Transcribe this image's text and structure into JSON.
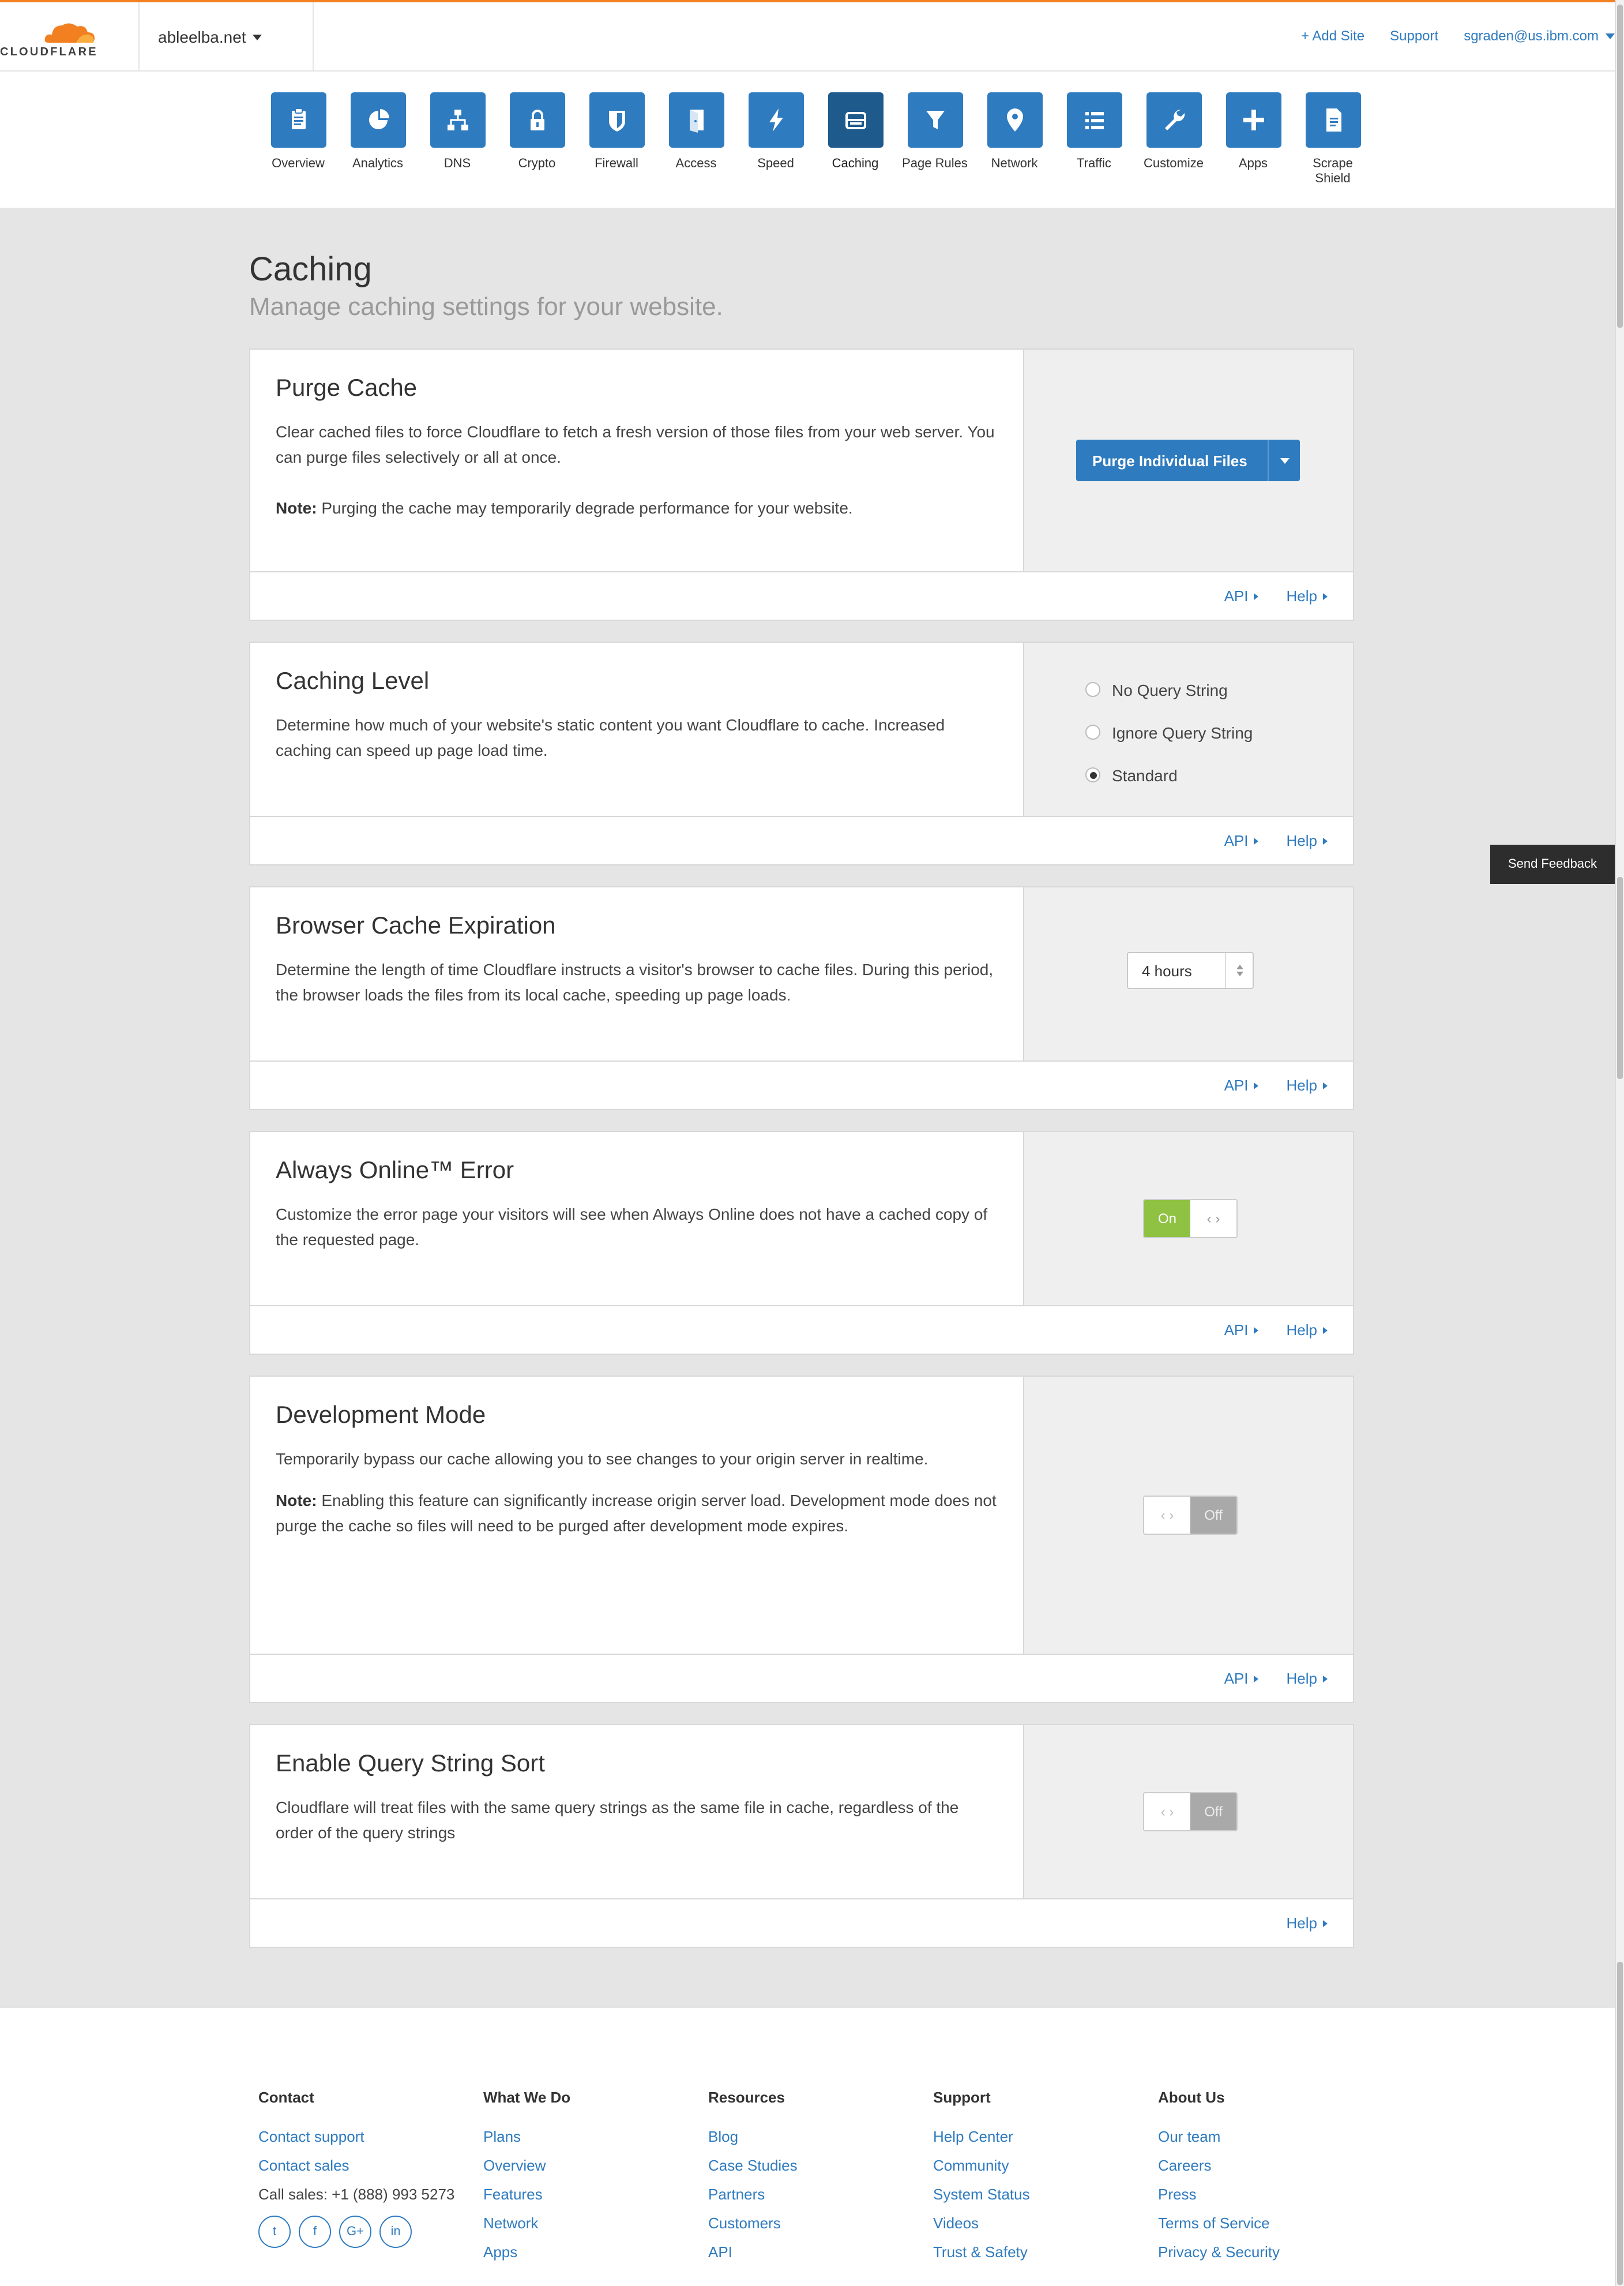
{
  "brand": {
    "logo_text": "CLOUDFLARE",
    "accent": "#f38020",
    "primary": "#2f7bbf"
  },
  "header": {
    "domain": "ableelba.net",
    "add_site": "+ Add Site",
    "support": "Support",
    "account": "sgraden@us.ibm.com"
  },
  "nav": [
    {
      "label": "Overview",
      "icon": "clipboard-icon"
    },
    {
      "label": "Analytics",
      "icon": "pie-chart-icon"
    },
    {
      "label": "DNS",
      "icon": "network-tree-icon"
    },
    {
      "label": "Crypto",
      "icon": "lock-icon"
    },
    {
      "label": "Firewall",
      "icon": "shield-icon"
    },
    {
      "label": "Access",
      "icon": "door-icon"
    },
    {
      "label": "Speed",
      "icon": "lightning-icon"
    },
    {
      "label": "Caching",
      "icon": "server-drive-icon",
      "active": true
    },
    {
      "label": "Page Rules",
      "icon": "filter-icon"
    },
    {
      "label": "Network",
      "icon": "location-pin-icon"
    },
    {
      "label": "Traffic",
      "icon": "list-icon"
    },
    {
      "label": "Customize",
      "icon": "wrench-icon"
    },
    {
      "label": "Apps",
      "icon": "plus-icon"
    },
    {
      "label": "Scrape Shield",
      "icon": "document-icon"
    }
  ],
  "page": {
    "title": "Caching",
    "subtitle": "Manage caching settings for your website."
  },
  "cards": {
    "purge": {
      "title": "Purge Cache",
      "desc": "Clear cached files to force Cloudflare to fetch a fresh version of those files from your web server. You can purge files selectively or all at once.",
      "note_label": "Note:",
      "note": " Purging the cache may temporarily degrade performance for your website.",
      "button": "Purge Individual Files",
      "api": "API",
      "help": "Help"
    },
    "level": {
      "title": "Caching Level",
      "desc": "Determine how much of your website's static content you want Cloudflare to cache. Increased caching can speed up page load time.",
      "options": [
        "No Query String",
        "Ignore Query String",
        "Standard"
      ],
      "selected": "Standard",
      "api": "API",
      "help": "Help"
    },
    "browser": {
      "title": "Browser Cache Expiration",
      "desc": "Determine the length of time Cloudflare instructs a visitor's browser to cache files. During this period, the browser loads the files from its local cache, speeding up page loads.",
      "value": "4 hours",
      "api": "API",
      "help": "Help"
    },
    "online": {
      "title": "Always Online™ Error",
      "desc": "Customize the error page your visitors will see when Always Online does not have a cached copy of the requested page.",
      "on_label": "On",
      "handle": "‹ ›",
      "state": "On",
      "api": "API",
      "help": "Help"
    },
    "devmode": {
      "title": "Development Mode",
      "desc": "Temporarily bypass our cache allowing you to see changes to your origin server in realtime.",
      "note_label": "Note:",
      "note": " Enabling this feature can significantly increase origin server load. Development mode does not purge the cache so files will need to be purged after development mode expires.",
      "handle": "‹ ›",
      "off_label": "Off",
      "state": "Off",
      "api": "API",
      "help": "Help"
    },
    "qsort": {
      "title": "Enable Query String Sort",
      "desc": "Cloudflare will treat files with the same query strings as the same file in cache, regardless of the order of the query strings",
      "handle": "‹ ›",
      "off_label": "Off",
      "state": "Off",
      "help": "Help"
    }
  },
  "feedback": "Send Feedback",
  "footer": {
    "contact": {
      "title": "Contact",
      "links": [
        "Contact support",
        "Contact sales"
      ],
      "call": "Call sales: +1 (888) 993 5273",
      "socials": [
        "t",
        "f",
        "G+",
        "in"
      ]
    },
    "what": {
      "title": "What We Do",
      "links": [
        "Plans",
        "Overview",
        "Features",
        "Network",
        "Apps"
      ]
    },
    "resources": {
      "title": "Resources",
      "links": [
        "Blog",
        "Case Studies",
        "Partners",
        "Customers",
        "API"
      ]
    },
    "support": {
      "title": "Support",
      "links": [
        "Help Center",
        "Community",
        "System Status",
        "Videos",
        "Trust & Safety"
      ]
    },
    "about": {
      "title": "About Us",
      "links": [
        "Our team",
        "Careers",
        "Press",
        "Terms of Service",
        "Privacy & Security"
      ]
    }
  }
}
